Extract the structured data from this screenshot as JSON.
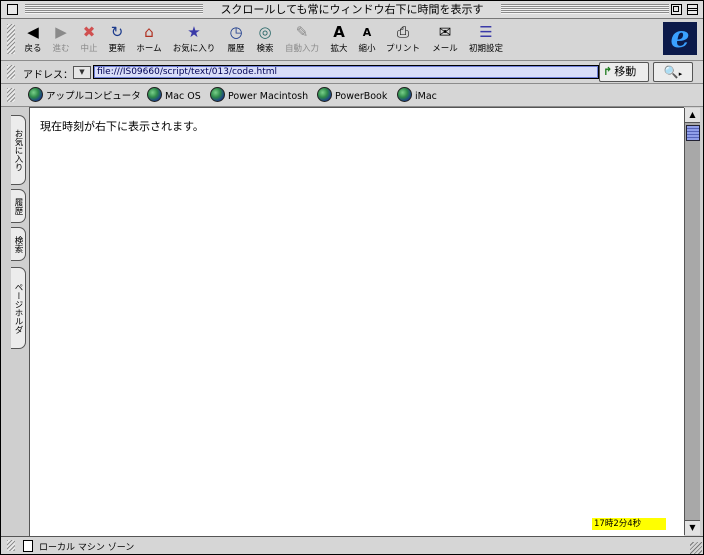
{
  "window": {
    "title": "スクロールしても常にウィンドウ右下に時間を表示す"
  },
  "toolbar": {
    "buttons": [
      {
        "label": "戻る",
        "icon": "◀"
      },
      {
        "label": "進む",
        "icon": "▶"
      },
      {
        "label": "中止",
        "icon": "✖"
      },
      {
        "label": "更新",
        "icon": "↻"
      },
      {
        "label": "ホーム",
        "icon": "⌂"
      },
      {
        "label": "お気に入り",
        "icon": "★"
      },
      {
        "label": "履歴",
        "icon": "◷"
      },
      {
        "label": "検索",
        "icon": "◎"
      },
      {
        "label": "自動入力",
        "icon": "✎"
      },
      {
        "label": "拡大",
        "icon": "A"
      },
      {
        "label": "縮小",
        "icon": "A"
      },
      {
        "label": "プリント",
        "icon": "⎙"
      },
      {
        "label": "メール",
        "icon": "✉"
      },
      {
        "label": "初期設定",
        "icon": "☰"
      }
    ]
  },
  "address": {
    "label": "アドレス：",
    "url": "file:///IS09660/script/text/013/code.html",
    "go_label": "移動"
  },
  "favorites": [
    "アップルコンピュータ",
    "Mac OS",
    "Power Macintosh",
    "PowerBook",
    "iMac"
  ],
  "side_tabs": [
    "お気に入り",
    "履歴",
    "検索",
    "ページホルダ"
  ],
  "content": {
    "text": "現在時刻が右下に表示されます。",
    "clock": "17時2分4秒"
  },
  "status": {
    "text": "ローカル マシン ゾーン"
  },
  "colors": {
    "clock_bg": "#ffff00",
    "address_bg": "#d8ddf8",
    "logo_bg": "#0c1a4a"
  }
}
